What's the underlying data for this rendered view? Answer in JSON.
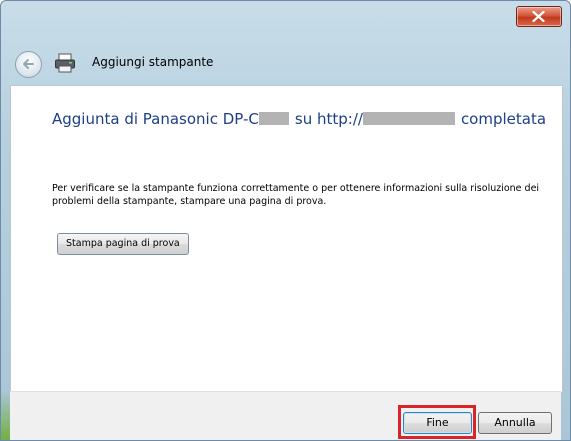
{
  "window": {
    "close_symbol": "✕"
  },
  "header": {
    "title": "Aggiungi stampante",
    "back_icon": "back-arrow-icon",
    "printer_icon": "printer-icon"
  },
  "main": {
    "headline_part1": "Aggiunta di Panasonic DP-C",
    "headline_part2": "su http://",
    "headline_part3": "completata",
    "description": "Per verificare se la stampante funziona correttamente o per ottenere informazioni sulla risoluzione dei problemi della stampante, stampare una pagina di prova.",
    "test_page_button": "Stampa pagina di prova"
  },
  "footer": {
    "finish_button": "Fine",
    "cancel_button": "Annulla"
  },
  "colors": {
    "headline": "#1e3e87",
    "highlight": "#d9252a",
    "close_button": "#c23a1d"
  }
}
